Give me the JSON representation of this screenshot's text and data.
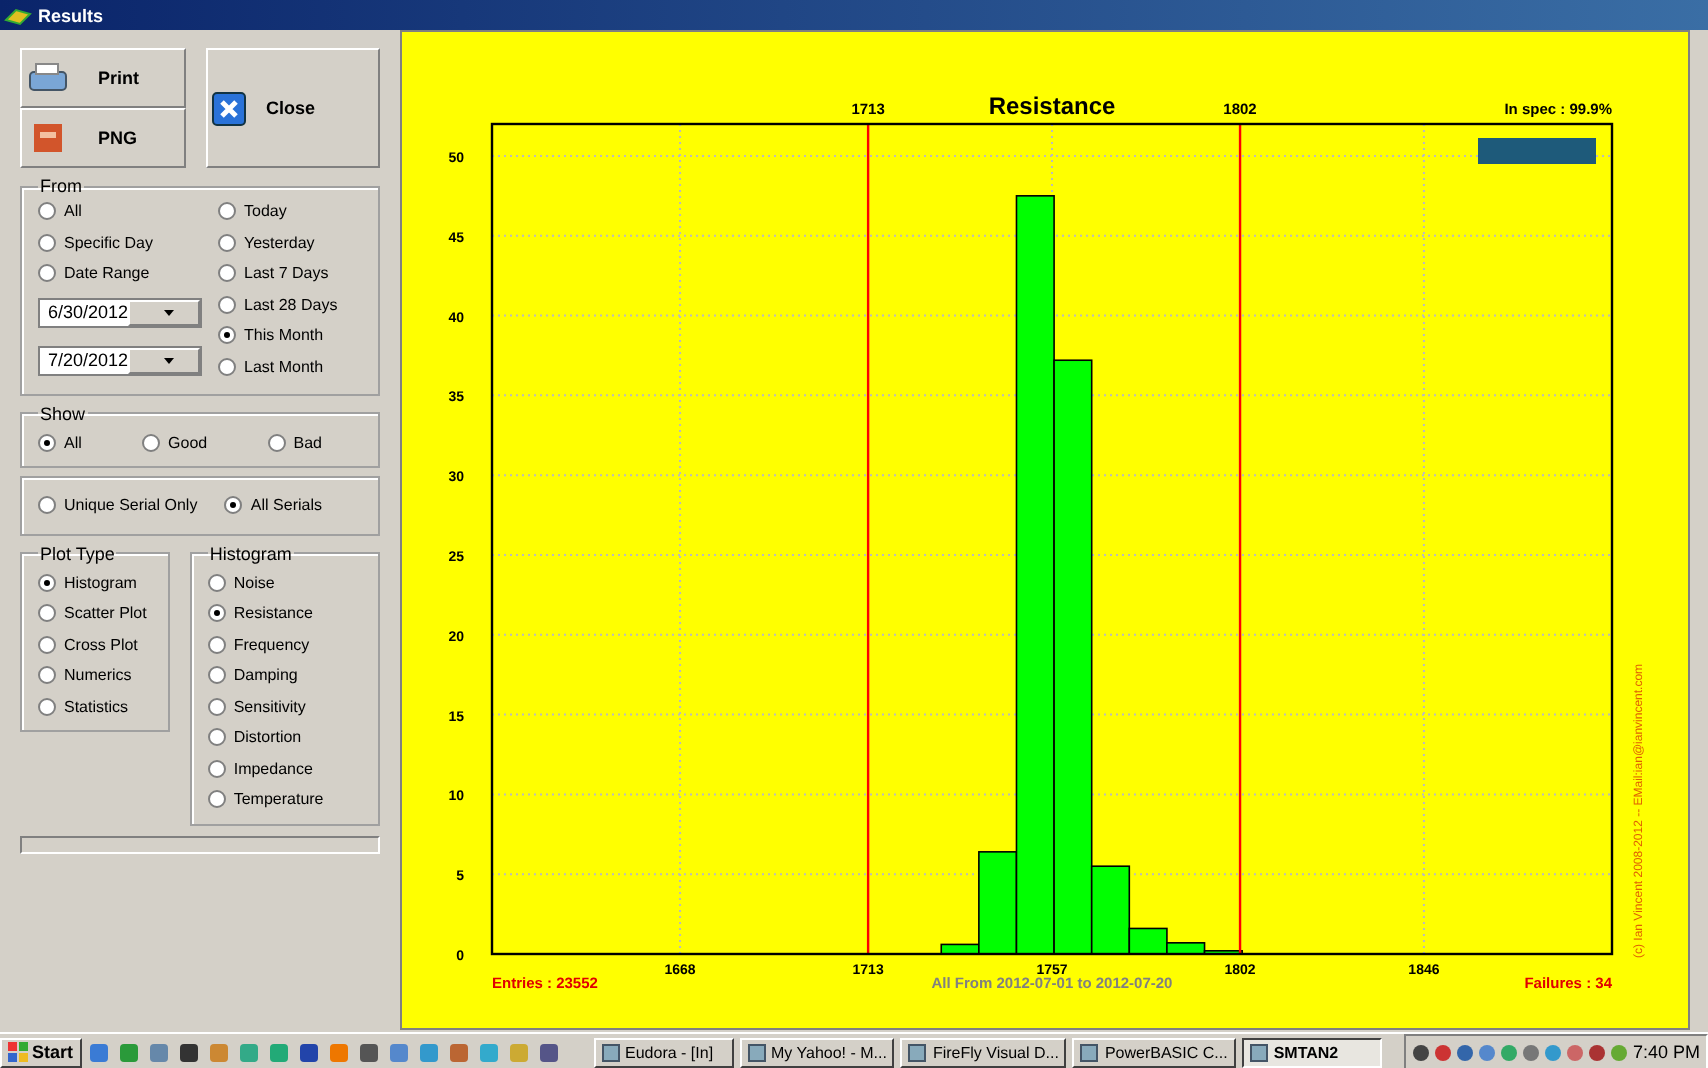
{
  "window": {
    "title": "Results"
  },
  "action_buttons": [
    {
      "label": "Print",
      "kind": "print"
    },
    {
      "label": "PNG",
      "kind": "png"
    }
  ],
  "close_button": {
    "label": "Close"
  },
  "from": {
    "title": "From",
    "left_options": [
      {
        "label": "All",
        "selected": false
      },
      {
        "label": "Specific Day",
        "selected": false
      },
      {
        "label": "Date Range",
        "selected": false
      }
    ],
    "right_options": [
      {
        "label": "Today",
        "selected": false
      },
      {
        "label": "Yesterday",
        "selected": false
      },
      {
        "label": "Last 7 Days",
        "selected": false
      },
      {
        "label": "Last 28 Days",
        "selected": false
      },
      {
        "label": "This Month",
        "selected": true
      },
      {
        "label": "Last Month",
        "selected": false
      }
    ],
    "dates": [
      {
        "value": "6/30/2012"
      },
      {
        "value": "7/20/2012"
      }
    ]
  },
  "show": {
    "title": "Show",
    "options": [
      {
        "label": "All",
        "selected": true
      },
      {
        "label": "Good",
        "selected": false
      },
      {
        "label": "Bad",
        "selected": false
      }
    ]
  },
  "serials": {
    "options": [
      {
        "label": "Unique Serial Only",
        "selected": false
      },
      {
        "label": "All Serials",
        "selected": true
      }
    ]
  },
  "plot_type": {
    "title": "Plot Type",
    "options": [
      {
        "label": "Histogram",
        "selected": true
      },
      {
        "label": "Scatter Plot",
        "selected": false
      },
      {
        "label": "Cross Plot",
        "selected": false
      },
      {
        "label": "Numerics",
        "selected": false
      },
      {
        "label": "Statistics",
        "selected": false
      }
    ]
  },
  "progress": {
    "level": 0
  },
  "histogram": {
    "title": "Histogram",
    "options": [
      {
        "label": "Noise",
        "selected": false
      },
      {
        "label": "Resistance",
        "selected": true
      },
      {
        "label": "Frequency",
        "selected": false
      },
      {
        "label": "Damping",
        "selected": false
      },
      {
        "label": "Sensitivity",
        "selected": false
      },
      {
        "label": "Distortion",
        "selected": false
      },
      {
        "label": "Impedance",
        "selected": false
      },
      {
        "label": "Temperature",
        "selected": false
      }
    ]
  },
  "chart": {
    "in_spec": "In spec : 99.9%",
    "entries": "Entries : 23552",
    "range": "All From 2012-07-01 to 2012-07-20",
    "failures": "Failures : 34",
    "copyright": "(c) Ian Vincent 2008-2012 -- EMail:ian@ianvincent.com",
    "chart_data": {
      "type": "bar",
      "title": "Resistance",
      "x": [
        1735,
        1744,
        1753,
        1762,
        1771,
        1780,
        1789,
        1798
      ],
      "values": [
        0.6,
        6.4,
        47.5,
        37.2,
        5.5,
        1.6,
        0.7,
        0.2
      ],
      "grid": true,
      "xlim": [
        1623,
        1891
      ],
      "ylim": [
        0,
        52
      ],
      "xticks": [
        1668,
        1713,
        1757,
        1802,
        1846
      ],
      "yticks": [
        0,
        5,
        10,
        15,
        20,
        25,
        30,
        35,
        40,
        45,
        50
      ],
      "ref_lines": [
        {
          "axis": "x",
          "value": 1713,
          "label": "1713"
        },
        {
          "axis": "x",
          "value": 1802,
          "label": "1802"
        }
      ]
    }
  },
  "taskbar": {
    "start": "Start",
    "tasks": [
      {
        "label": "Eudora - [In]",
        "selected": false
      },
      {
        "label": "My Yahoo! - M...",
        "selected": false
      },
      {
        "label": "FireFly Visual D...",
        "selected": false
      },
      {
        "label": "PowerBASIC C...",
        "selected": false
      },
      {
        "label": "SMTAN2",
        "selected": true
      }
    ],
    "clock": "7:40 PM"
  }
}
